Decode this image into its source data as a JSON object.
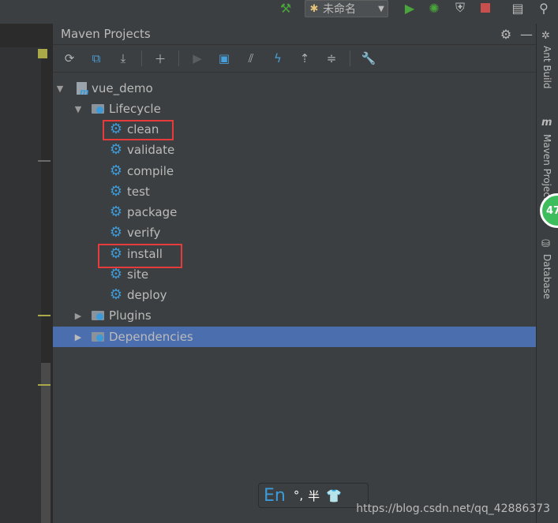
{
  "toolbar": {
    "run_config": "未命名",
    "icons": [
      "hammer-icon",
      "run-config-icon",
      "run-icon",
      "debug-icon",
      "coverage-icon",
      "stop-icon",
      "project-structure-icon",
      "search-icon"
    ],
    "colors": {
      "run": "#49a53c",
      "stop": "#c94f4f",
      "hammer": "#49a53c"
    }
  },
  "panel": {
    "title": "Maven Projects",
    "header_buttons": [
      "settings-icon",
      "minimize-icon"
    ],
    "tools": [
      "reimport-icon",
      "generate-sources-icon",
      "download-icon",
      "add-icon",
      "run-maven-icon",
      "execute-goal-icon",
      "toggle-offline-icon",
      "skip-tests-icon",
      "show-dependencies-icon",
      "collapse-all-icon",
      "maven-settings-icon"
    ]
  },
  "tree": {
    "project": "vue_demo",
    "lifecycle": {
      "label": "Lifecycle",
      "goals": [
        "clean",
        "validate",
        "compile",
        "test",
        "package",
        "verify",
        "install",
        "site",
        "deploy"
      ]
    },
    "plugins": "Plugins",
    "dependencies": "Dependencies",
    "highlighted_goals": [
      "clean",
      "install"
    ],
    "selected": "Dependencies"
  },
  "rightbar": {
    "tabs": [
      "Ant Build",
      "Maven Projects",
      "Database"
    ],
    "badge": "47"
  },
  "ime": {
    "mode": "En",
    "punct": "°,",
    "half": "半",
    "skin_icon": "shirt-icon"
  },
  "watermark": "https://blog.csdn.net/qq_42886373",
  "colors": {
    "selection": "#4b6eaf",
    "highlight_box": "#e63b3b",
    "gear": "#3d9ad8"
  }
}
